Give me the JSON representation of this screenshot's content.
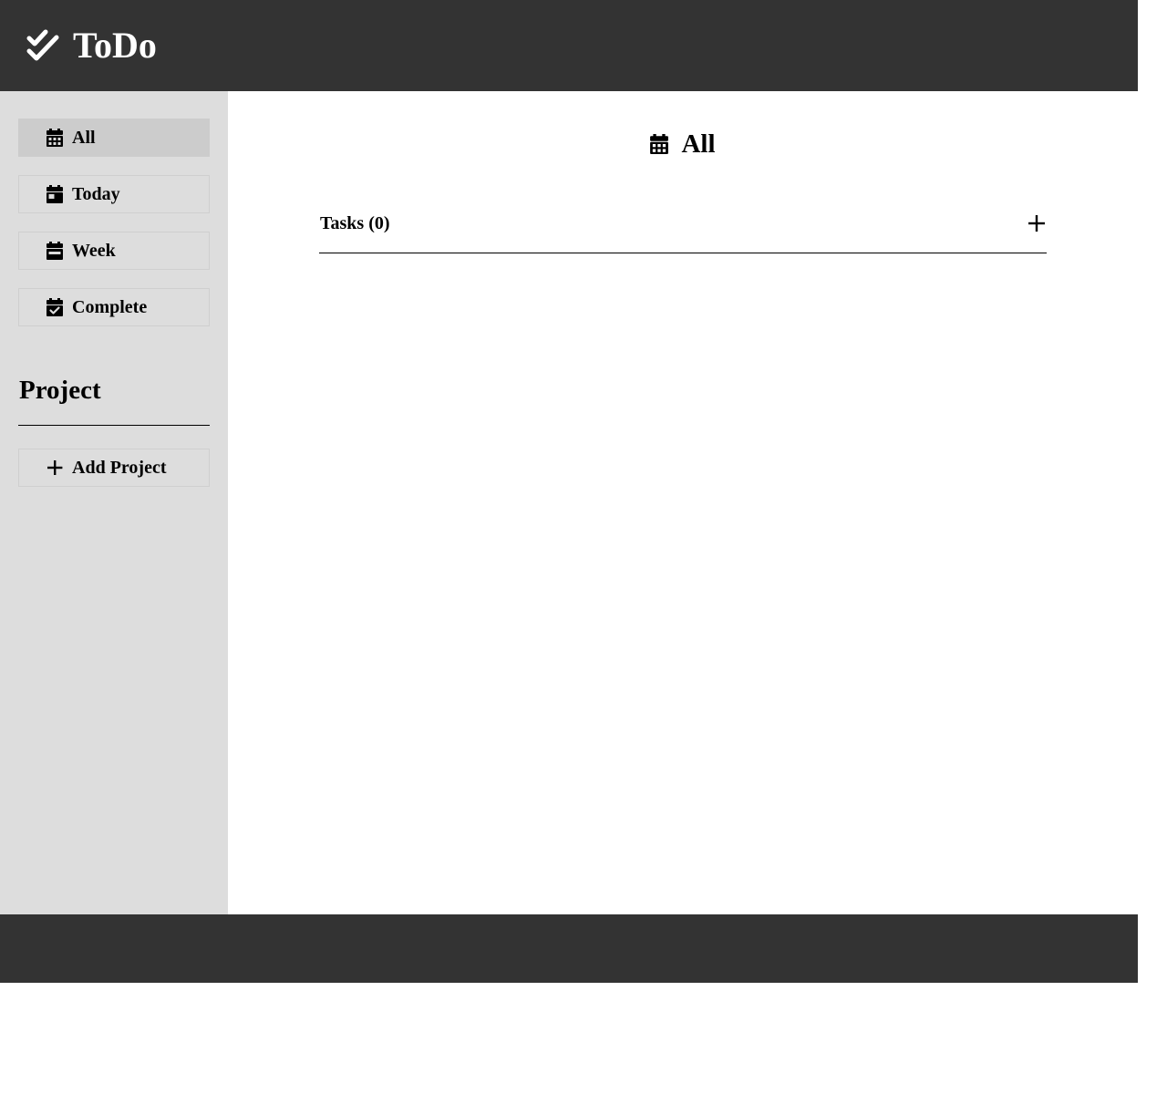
{
  "header": {
    "title": "ToDo",
    "icon": "double-check-icon",
    "background": "#333333",
    "title_color": "#ffffff"
  },
  "sidebar": {
    "background": "#dddddd",
    "items": [
      {
        "label": "All",
        "icon": "calendar-days-icon",
        "active": true
      },
      {
        "label": "Today",
        "icon": "calendar-day-icon",
        "active": false
      },
      {
        "label": "Week",
        "icon": "calendar-week-icon",
        "active": false
      },
      {
        "label": "Complete",
        "icon": "calendar-check-icon",
        "active": false
      }
    ],
    "project_heading": "Project",
    "add_project_label": "Add Project",
    "add_project_icon": "plus-icon"
  },
  "main": {
    "title": "All",
    "title_icon": "calendar-days-icon",
    "tasks_label": "Tasks (0)",
    "add_task_icon": "plus-icon"
  },
  "footer": {
    "background": "#333333"
  }
}
